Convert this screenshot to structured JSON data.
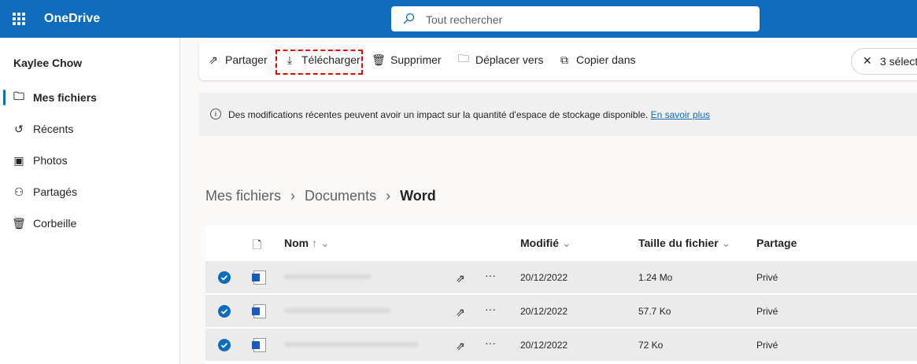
{
  "app": {
    "title": "OneDrive",
    "search_placeholder": "Tout rechercher"
  },
  "sidebar": {
    "user": "Kaylee Chow",
    "items": [
      {
        "label": "Mes fichiers",
        "icon": "folder-icon"
      },
      {
        "label": "Récents",
        "icon": "history-icon"
      },
      {
        "label": "Photos",
        "icon": "image-icon"
      },
      {
        "label": "Partagés",
        "icon": "people-icon"
      },
      {
        "label": "Corbeille",
        "icon": "recycle-bin-icon"
      }
    ]
  },
  "toolbar": {
    "share": "Partager",
    "download": "Télécharger",
    "delete": "Supprimer",
    "move": "Déplacer vers",
    "copy": "Copier dans",
    "selection": "3 sélect"
  },
  "banner": {
    "text": "Des modifications récentes peuvent avoir un impact sur la quantité d'espace de stockage disponible.",
    "link": "En savoir plus"
  },
  "breadcrumb": [
    "Mes fichiers",
    "Documents",
    "Word"
  ],
  "columns": {
    "name": "Nom",
    "modified": "Modifié",
    "size": "Taille du fichier",
    "sharing": "Partage"
  },
  "files": [
    {
      "modified": "20/12/2022",
      "size": "1.24 Mo",
      "sharing": "Privé"
    },
    {
      "modified": "20/12/2022",
      "size": "57.7 Ko",
      "sharing": "Privé"
    },
    {
      "modified": "20/12/2022",
      "size": "72 Ko",
      "sharing": "Privé"
    }
  ]
}
